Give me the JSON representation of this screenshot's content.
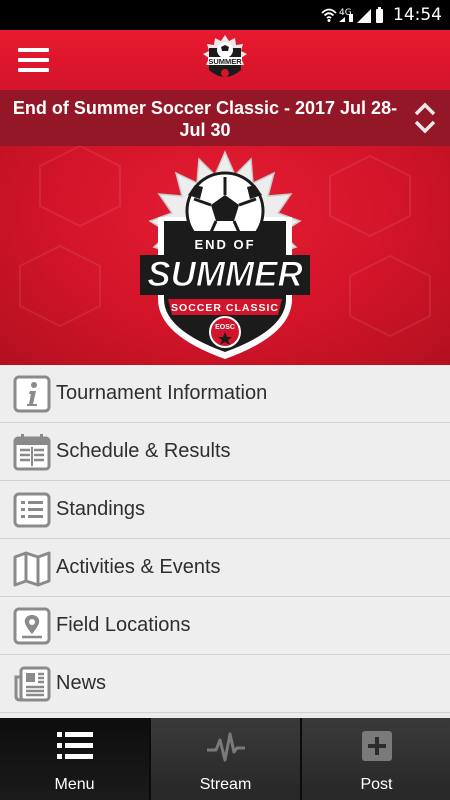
{
  "status_bar": {
    "time": "14:54",
    "network": "4G"
  },
  "header": {
    "menu_icon": "hamburger-icon",
    "logo_alt_top": "END OF",
    "logo_alt_main": "SUMMER"
  },
  "event": {
    "title": "End of Summer Soccer Classic - 2017 Jul 28-Jul 30",
    "switch_icon": "up-down-chevron-icon"
  },
  "hero": {
    "logo_top": "END OF",
    "logo_main": "SUMMER",
    "logo_sub": "SOCCER CLASSIC",
    "logo_badge": "EOSC"
  },
  "menu": {
    "items": [
      {
        "label": "Tournament Information",
        "icon": "info-icon"
      },
      {
        "label": "Schedule & Results",
        "icon": "calendar-icon"
      },
      {
        "label": "Standings",
        "icon": "list-icon"
      },
      {
        "label": "Activities & Events",
        "icon": "map-icon"
      },
      {
        "label": "Field Locations",
        "icon": "location-pin-icon"
      },
      {
        "label": "News",
        "icon": "newspaper-icon"
      }
    ]
  },
  "tabs": [
    {
      "label": "Menu",
      "icon": "menu-list-icon",
      "active": true
    },
    {
      "label": "Stream",
      "icon": "pulse-icon",
      "active": false
    },
    {
      "label": "Post",
      "icon": "plus-icon",
      "active": false
    }
  ],
  "colors": {
    "brand_red": "#d3142b",
    "title_bar": "#941727",
    "nav_bg": "#141414"
  }
}
